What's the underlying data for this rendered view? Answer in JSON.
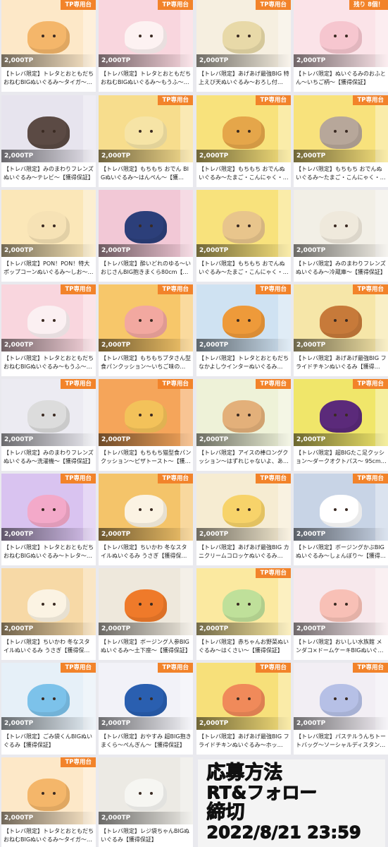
{
  "badge_label": "TP専用台",
  "notice": {
    "line1": "応募方法",
    "line2": "RT&フォロー",
    "line3": "締切",
    "line4": "2022/8/21 23:59"
  },
  "cards": [
    {
      "title": "【トレバ限定】トレタとおともだち おねむBIGぬいぐるみ～タイガ～…",
      "price": "2,000TP",
      "badge": "TP専用台",
      "color": "#f4b66a",
      "bg": "#fde8c8"
    },
    {
      "title": "【トレバ限定】トレタとおともだち おねむBIGぬいぐるみ～もうふ～…",
      "price": "2,000TP",
      "badge": "TP専用台",
      "color": "#fdf2f2",
      "bg": "#f9d6de"
    },
    {
      "title": "【トレバ限定】あげあげ最強BIG 特上えび天ぬいぐるみ～おろし付…",
      "price": "2,000TP",
      "badge": "TP専用台",
      "color": "#e8d9a8",
      "bg": "#f6efe0"
    },
    {
      "title": "【トレバ限定】ぬいぐるみのおふとん～いちご柄～【獲得保証】",
      "price": "2,000TP",
      "badge": "残り 8個！",
      "color": "#f6c6cf",
      "bg": "#fbe3e8"
    },
    {
      "title": "【トレバ限定】みのまわりフレンズ ぬいぐるみ～テレビ～【獲得保証】",
      "price": "2,000TP",
      "badge": "",
      "color": "#5b4a44",
      "bg": "#e7e4ee"
    },
    {
      "title": "【トレバ限定】もちもち おでん BIGぬいぐるみ～はんぺん～【獲…",
      "price": "2,000TP",
      "badge": "TP専用台",
      "color": "#f6e4a6",
      "bg": "#f7dd8d"
    },
    {
      "title": "【トレバ限定】もちもち おでんぬ いぐるみ～たまご・こんにゃく・…",
      "price": "2,000TP",
      "badge": "TP専用台",
      "color": "#e5a64a",
      "bg": "#f8e27c"
    },
    {
      "title": "【トレバ限定】もちもち おでんぬ いぐるみ～たまご・こんにゃく・…",
      "price": "2,000TP",
      "badge": "TP専用台",
      "color": "#b7a79a",
      "bg": "#f8e27c"
    },
    {
      "title": "【トレバ限定】PON！PON！特大 ポップコーンぬいぐるみ～しお～…",
      "price": "2,000TP",
      "badge": "",
      "color": "#f6e2b5",
      "bg": "#fbe7b8"
    },
    {
      "title": "【トレバ限定】酔いどれのゆる～い おじさんBIG抱きまくら80cm【…",
      "price": "2,000TP",
      "badge": "",
      "color": "#2c3f7a",
      "bg": "#f2c8d6"
    },
    {
      "title": "【トレバ限定】もちもち おでんぬ いぐるみ～たまご・こんにゃく・…",
      "price": "2,000TP",
      "badge": "",
      "color": "#e8c58c",
      "bg": "#f8e27c"
    },
    {
      "title": "【トレバ限定】みのまわりフレンズ ぬいぐるみ～冷蔵庫～【獲得保証】",
      "price": "2,000TP",
      "badge": "",
      "color": "#efe9dc",
      "bg": "#f2efe6"
    },
    {
      "title": "【トレバ限定】トレタとおともだち おねむBIGぬいぐるみ～もうふ～…",
      "price": "2,000TP",
      "badge": "TP専用台",
      "color": "#fbf0f2",
      "bg": "#f9d6de"
    },
    {
      "title": "【トレバ限定】もちもちブタさん型 食パンクッション～いちご味の…",
      "price": "2,000TP",
      "badge": "TP専用台",
      "color": "#f2a8a0",
      "bg": "#f7c76a"
    },
    {
      "title": "【トレバ限定】トレタとおともだち なかよしウインターぬいぐるみ…",
      "price": "2,000TP",
      "badge": "TP専用台",
      "color": "#ee9a3a",
      "bg": "#cfe2f2"
    },
    {
      "title": "【トレバ限定】あげあげ最強BIG フライドチキンぬいぐるみ【獲得…",
      "price": "2,000TP",
      "badge": "TP専用台",
      "color": "#c77a3a",
      "bg": "#f6e6a8"
    },
    {
      "title": "【トレバ限定】みのまわりフレンズ ぬいぐるみ～洗濯機～【獲得保証】",
      "price": "2,000TP",
      "badge": "TP専用台",
      "color": "#dcdcdc",
      "bg": "#ecebf2"
    },
    {
      "title": "【トレバ限定】もちもち猫型食パン クッション～ピザトースト～【獲…",
      "price": "2,000TP",
      "badge": "TP専用台",
      "color": "#f3c25a",
      "bg": "#f5a55a"
    },
    {
      "title": "【トレバ限定】アイスの棒ロングク ッション～はずれじゃないよ、あ…",
      "price": "2,000TP",
      "badge": "TP専用台",
      "color": "#e3b07a",
      "bg": "#eef2d8"
    },
    {
      "title": "【トレバ限定】超BIGたこ足クッシ ョン～ダークオクトパス～ 95cm…",
      "price": "2,000TP",
      "badge": "TP専用台",
      "color": "#5b2a7a",
      "bg": "#f0e66a"
    },
    {
      "title": "【トレバ限定】トレタとおともだち おねむBIGぬいぐるみ～トレタ～…",
      "price": "2,000TP",
      "badge": "TP専用台",
      "color": "#f3a9c9",
      "bg": "#d9c3f0"
    },
    {
      "title": "【トレバ限定】ちいかわ 冬なスタ イルぬいぐるみ うさぎ【獲得保…",
      "price": "2,000TP",
      "badge": "TP専用台",
      "color": "#fbf3e3",
      "bg": "#f4c46a"
    },
    {
      "title": "【トレバ限定】あげあげ最強BIG カニクリームコロッケぬいぐるみ…",
      "price": "2,000TP",
      "badge": "TP専用台",
      "color": "#f7d36a",
      "bg": "#f6ecd2"
    },
    {
      "title": "【トレバ限定】ボージングかぶBIG ぬいぐるみ～しょんぼり～【獲得…",
      "price": "2,000TP",
      "badge": "TP専用台",
      "color": "#ffffff",
      "bg": "#c8d4e6"
    },
    {
      "title": "【トレバ限定】ちいかわ 冬なスタ イルぬいぐるみ うさぎ【獲得保…",
      "price": "2,000TP",
      "badge": "",
      "color": "#fbf3e3",
      "bg": "#f7d9a6"
    },
    {
      "title": "【トレバ限定】ボージング人参BIG ぬいぐるみ～土下座～【獲得保証】",
      "price": "2,000TP",
      "badge": "",
      "color": "#ef7a2a",
      "bg": "#eee8dc"
    },
    {
      "title": "【トレバ限定】赤ちゃんお野菜ぬい ぐるみ～はくさい～【獲得保証】",
      "price": "2,000TP",
      "badge": "TP専用台",
      "color": "#bfe09a",
      "bg": "#fbe9a0"
    },
    {
      "title": "【トレバ限定】おいしい水族館 メ ンダコ×ドームケーキBIGぬいぐ…",
      "price": "2,000TP",
      "badge": "",
      "color": "#f8c0b6",
      "bg": "#f7e8ec"
    },
    {
      "title": "【トレバ限定】ごみ袋くんBIGぬい ぐるみ【獲得保証】",
      "price": "2,000TP",
      "badge": "TP専用台",
      "color": "#7cc2ea",
      "bg": "#e6f0f8"
    },
    {
      "title": "【トレバ限定】おやすみ 超BIG抱き まくら～ぺんぎん～【獲得保証】",
      "price": "2,000TP",
      "badge": "TP専用台",
      "color": "#2a5fb0",
      "bg": "#f2f2f8"
    },
    {
      "title": "【トレバ限定】あげあげ最強BIG フライドチキンぬいぐるみ～ホッ…",
      "price": "2,000TP",
      "badge": "TP専用台",
      "color": "#f08a5a",
      "bg": "#f7e07a"
    },
    {
      "title": "【トレバ限定】パステルうんちトー トバッグ～ソーシャルディスタン…",
      "price": "2,000TP",
      "badge": "TP専用台",
      "color": "#b6c0e6",
      "bg": "#f2eef4"
    },
    {
      "title": "【トレバ限定】トレタとおともだち おねむBIGぬいぐるみ～タイガ～…",
      "price": "2,000TP",
      "badge": "TP専用台",
      "color": "#f4b66a",
      "bg": "#fde8c8"
    },
    {
      "title": "【トレバ限定】レジ袋ちゃんBIGぬ いぐるみ【獲得保証】",
      "price": "2,000TP",
      "badge": "",
      "color": "#f6f6f2",
      "bg": "#eceae4"
    }
  ]
}
